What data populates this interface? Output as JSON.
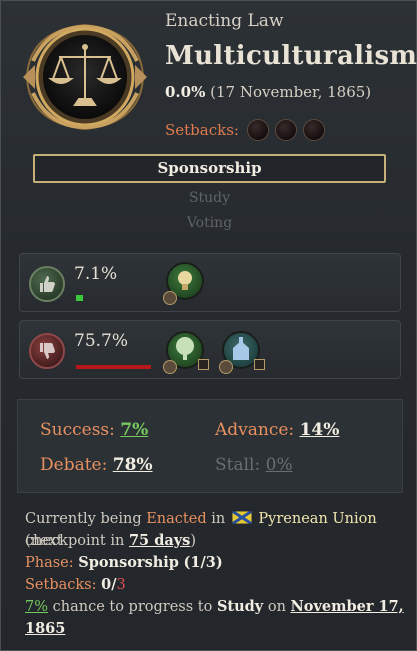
{
  "header": {
    "subtitle": "Enacting Law",
    "law_name": "Multiculturalism",
    "progress_value": "0.0%",
    "progress_date": "(17 November, 1865)",
    "setbacks_label": "Setbacks:",
    "setbacks_total": 3,
    "emblem_icon": "scales-of-justice-icon"
  },
  "stages": {
    "current": "Sponsorship",
    "next1": "Study",
    "next2": "Voting"
  },
  "support": {
    "value": "7.1%",
    "bar_fraction": 0.071,
    "bar_color": "#3cc83c",
    "icon": "thumbs-up-icon",
    "groups": [
      {
        "icon": "industrialists-lightbulb-icon",
        "leader": "leader-portrait-icon"
      }
    ]
  },
  "opposition": {
    "value": "75.7%",
    "bar_fraction": 0.757,
    "bar_color": "#b81818",
    "icon": "thumbs-down-icon",
    "groups": [
      {
        "icon": "landowners-tree-icon",
        "leader": "leader-portrait-icon"
      },
      {
        "icon": "devout-church-icon",
        "leader": "leader-portrait-icon"
      }
    ]
  },
  "chances": {
    "success_label": "Success:",
    "success_value": "7%",
    "advance_label": "Advance:",
    "advance_value": "14%",
    "debate_label": "Debate:",
    "debate_value": "78%",
    "stall_label": "Stall:",
    "stall_value": "0%"
  },
  "footer": {
    "line1_a": "Currently being ",
    "line1_enacted": "Enacted",
    "line1_b": " in ",
    "country": "Pyrenean Union",
    "line1_c": " (next",
    "line2_a": "checkpoint in ",
    "days": "75 days",
    "line2_b": ")",
    "phase_label": "Phase:",
    "phase_value": "Sponsorship",
    "phase_count": "(1/3)",
    "setbacks_label": "Setbacks:",
    "setbacks_current": "0",
    "setbacks_sep": "/",
    "setbacks_max": "3",
    "chance_value": "7%",
    "chance_text": " chance to progress to ",
    "chance_stage": "Study",
    "chance_on": " on ",
    "chance_date1": "November 17,",
    "chance_date2": "1865"
  }
}
